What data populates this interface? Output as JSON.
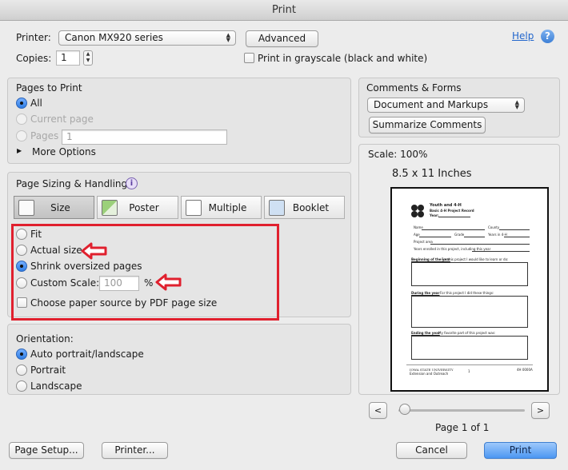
{
  "window": {
    "title": "Print"
  },
  "header": {
    "printer_label": "Printer:",
    "printer_value": "Canon MX920 series",
    "advanced_button": "Advanced",
    "copies_label": "Copies:",
    "copies_value": "1",
    "grayscale_label": "Print in grayscale (black and white)",
    "grayscale_checked": false,
    "help_link": "Help"
  },
  "pages_to_print": {
    "title": "Pages to Print",
    "all_label": "All",
    "current_page_label": "Current page",
    "pages_label": "Pages",
    "pages_value": "1",
    "more_options_label": "More Options",
    "selected": "all"
  },
  "page_sizing": {
    "title": "Page Sizing & Handling",
    "modes": [
      {
        "label": "Size",
        "selected": true
      },
      {
        "label": "Poster",
        "selected": false
      },
      {
        "label": "Multiple",
        "selected": false
      },
      {
        "label": "Booklet",
        "selected": false
      }
    ],
    "fit_label": "Fit",
    "actual_size_label": "Actual size",
    "shrink_label": "Shrink oversized pages",
    "custom_scale_label": "Custom Scale:",
    "custom_scale_value": "100",
    "percent_sign": "%",
    "paper_source_label": "Choose paper source by PDF page size",
    "selected": "shrink",
    "highlight_color": "#e0202e"
  },
  "orientation": {
    "title": "Orientation:",
    "auto_label": "Auto portrait/landscape",
    "portrait_label": "Portrait",
    "landscape_label": "Landscape",
    "selected": "auto"
  },
  "comments_forms": {
    "title": "Comments & Forms",
    "select_value": "Document and Markups",
    "summarize_button": "Summarize Comments"
  },
  "preview": {
    "scale_label": "Scale: 100%",
    "paper_size": "8.5 x 11 Inches",
    "page_indicator": "Page 1 of 1",
    "prev_button": "<",
    "next_button": ">",
    "document": {
      "title_line1": "Youth and 4-H",
      "title_line2": "Basic 4-H Project Record",
      "year_label": "Year:",
      "name_label": "Name",
      "county_label": "County",
      "age_label": "Age",
      "grade_label": "Grade",
      "years_label": "Years in 4-H",
      "project_area_label": "Project area",
      "years_enrolled_label": "Years enrolled in this project, including this year",
      "section1_head": "Beginning of the year",
      "section1_text": "For this project I would like to learn or do:",
      "section2_head": "During the year",
      "section2_text": "For this project I did these things:",
      "section3_head": "Ending the year",
      "section3_text": "My favorite part of this project was:",
      "footer_university": "IOWA STATE UNIVERSITY",
      "footer_extension": "Extension and Outreach",
      "footer_page": "1",
      "footer_code": "4H 0000A"
    }
  },
  "footer": {
    "page_setup_button": "Page Setup...",
    "printer_button": "Printer...",
    "cancel_button": "Cancel",
    "print_button": "Print"
  },
  "colors": {
    "accent": "#4c97f2",
    "highlight": "#e0202e"
  }
}
